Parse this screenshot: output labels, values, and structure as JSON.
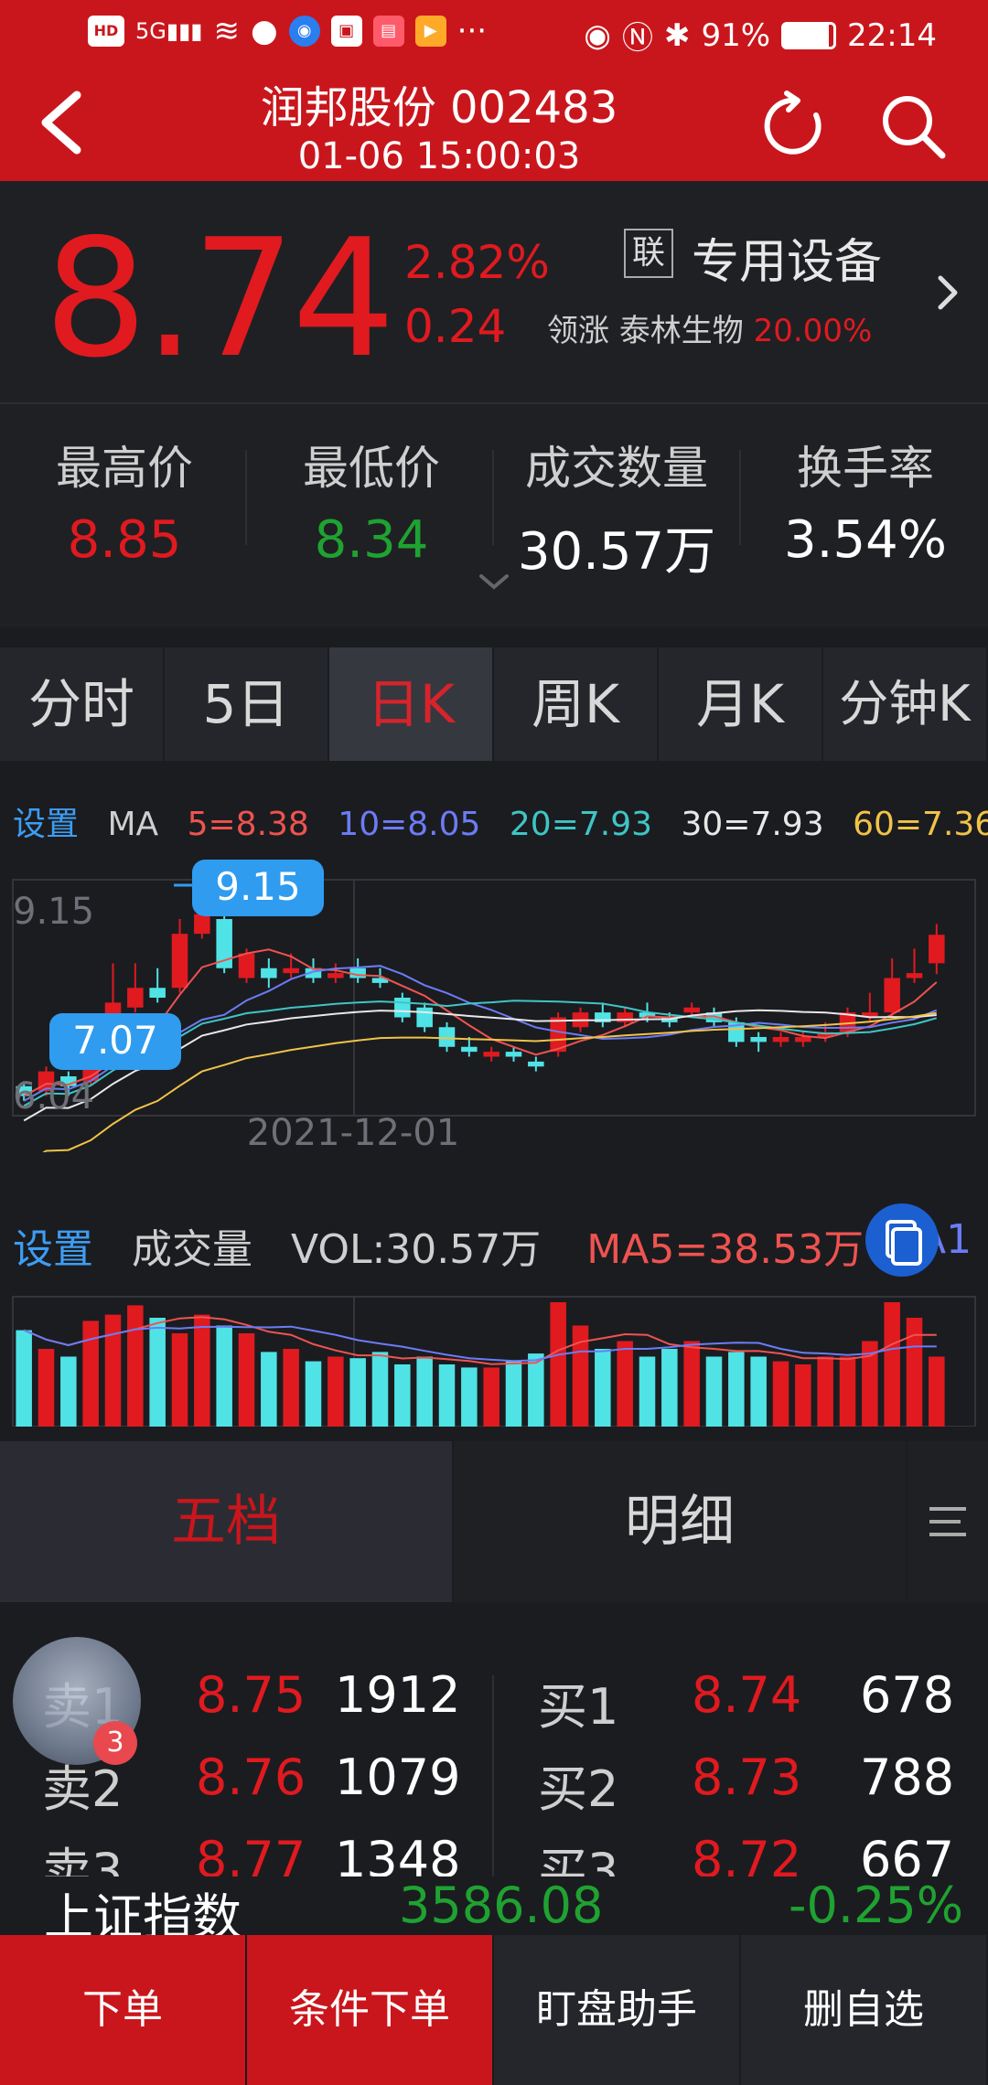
{
  "status_bar": {
    "left_tags": [
      "HD",
      "5G"
    ],
    "dots": "···",
    "battery": "91%",
    "time": "22:14"
  },
  "header": {
    "title": "润邦股份 002483",
    "datetime": "01-06 15:00:03"
  },
  "quote": {
    "price": "8.74",
    "change_pct": "2.82%",
    "change": "0.24",
    "sector_tag": "联",
    "sector_name": "专用设备",
    "lead_label": "领涨",
    "lead_stock": "泰林生物",
    "lead_pct": "20.00%"
  },
  "stats": [
    {
      "label": "最高价",
      "value": "8.85",
      "color": "#e01a1f"
    },
    {
      "label": "最低价",
      "value": "8.34",
      "color": "#1fa231"
    },
    {
      "label": "成交数量",
      "value": "30.57万",
      "color": "#ffffff"
    },
    {
      "label": "换手率",
      "value": "3.54%",
      "color": "#ffffff"
    }
  ],
  "tabs": [
    "分时",
    "5日",
    "日K",
    "周K",
    "月K",
    "分钟K"
  ],
  "active_tab": "日K",
  "ma": {
    "settings_label": "设置",
    "ma_label": "MA",
    "ma5": "5=8.38",
    "ma10": "10=8.05",
    "ma20": "20=7.93",
    "ma30": "30=7.93",
    "ma60": "60=7.36",
    "colors": {
      "ma5": "#ef5350",
      "ma10": "#6c7cf5",
      "ma20": "#3fc5c5",
      "ma30": "#e8e8e8",
      "ma60": "#f0c348"
    }
  },
  "kchart_labels": {
    "axis_high": "9.15",
    "axis_low": "6.04",
    "peak": "9.15",
    "trough": "7.07",
    "date": "2021-12-01"
  },
  "volume": {
    "settings_label": "设置",
    "label": "成交量",
    "vol": "VOL:30.57万",
    "ma5": "MA5=38.53万",
    "ma_cut": "A1"
  },
  "orderbook": {
    "tab_five": "五档",
    "tab_detail": "明细",
    "sell": [
      {
        "label": "卖1",
        "price": "8.75",
        "qty": "1912"
      },
      {
        "label": "卖2",
        "price": "8.76",
        "qty": "1079"
      },
      {
        "label": "卖3",
        "price": "8.77",
        "qty": "1348"
      }
    ],
    "buy": [
      {
        "label": "买1",
        "price": "8.74",
        "qty": "678"
      },
      {
        "label": "买2",
        "price": "8.73",
        "qty": "788"
      },
      {
        "label": "买3",
        "price": "8.72",
        "qty": "667"
      }
    ],
    "badge": "3"
  },
  "index_bar": {
    "name": "上证指数",
    "value": "3586.08",
    "change": "-0.25%"
  },
  "actions": [
    {
      "label": "下单",
      "bg": "#c9161c"
    },
    {
      "label": "条件下单",
      "bg": "#c9161c"
    },
    {
      "label": "盯盘助手",
      "bg": "#25262b"
    },
    {
      "label": "删自选",
      "bg": "#25262b"
    }
  ],
  "chart_data": {
    "type": "candlestick",
    "note_ma": "MA5 8.38, MA10 8.05, MA20 7.93, MA30 7.93, MA60 7.36",
    "candles": [
      {
        "o": 7.2,
        "c": 7.1,
        "h": 7.25,
        "l": 7.05
      },
      {
        "o": 7.15,
        "c": 7.35,
        "h": 7.4,
        "l": 7.1
      },
      {
        "o": 7.3,
        "c": 7.2,
        "h": 7.35,
        "l": 7.1
      },
      {
        "o": 7.25,
        "c": 7.55,
        "h": 7.6,
        "l": 7.2
      },
      {
        "o": 7.6,
        "c": 8.05,
        "h": 8.45,
        "l": 7.55
      },
      {
        "o": 8.0,
        "c": 8.2,
        "h": 8.45,
        "l": 7.95
      },
      {
        "o": 8.2,
        "c": 8.1,
        "h": 8.4,
        "l": 8.05
      },
      {
        "o": 8.2,
        "c": 8.75,
        "h": 8.9,
        "l": 8.15
      },
      {
        "o": 8.75,
        "c": 8.95,
        "h": 9.15,
        "l": 8.7
      },
      {
        "o": 8.9,
        "c": 8.4,
        "h": 9.05,
        "l": 8.35
      },
      {
        "o": 8.3,
        "c": 8.55,
        "h": 8.6,
        "l": 8.25
      },
      {
        "o": 8.4,
        "c": 8.3,
        "h": 8.5,
        "l": 8.2
      },
      {
        "o": 8.35,
        "c": 8.4,
        "h": 8.55,
        "l": 8.3
      },
      {
        "o": 8.4,
        "c": 8.3,
        "h": 8.5,
        "l": 8.25
      },
      {
        "o": 8.3,
        "c": 8.35,
        "h": 8.45,
        "l": 8.25
      },
      {
        "o": 8.4,
        "c": 8.3,
        "h": 8.5,
        "l": 8.25
      },
      {
        "o": 8.3,
        "c": 8.25,
        "h": 8.4,
        "l": 8.2
      },
      {
        "o": 8.1,
        "c": 7.9,
        "h": 8.15,
        "l": 7.85
      },
      {
        "o": 8.0,
        "c": 7.8,
        "h": 8.05,
        "l": 7.75
      },
      {
        "o": 7.8,
        "c": 7.6,
        "h": 7.85,
        "l": 7.55
      },
      {
        "o": 7.6,
        "c": 7.55,
        "h": 7.7,
        "l": 7.5
      },
      {
        "o": 7.5,
        "c": 7.55,
        "h": 7.6,
        "l": 7.45
      },
      {
        "o": 7.55,
        "c": 7.5,
        "h": 7.6,
        "l": 7.45
      },
      {
        "o": 7.45,
        "c": 7.4,
        "h": 7.5,
        "l": 7.35
      },
      {
        "o": 7.55,
        "c": 7.9,
        "h": 7.95,
        "l": 7.5
      },
      {
        "o": 7.8,
        "c": 7.95,
        "h": 8.0,
        "l": 7.75
      },
      {
        "o": 7.95,
        "c": 7.85,
        "h": 8.05,
        "l": 7.8
      },
      {
        "o": 7.85,
        "c": 7.95,
        "h": 8.0,
        "l": 7.8
      },
      {
        "o": 7.95,
        "c": 7.9,
        "h": 8.05,
        "l": 7.85
      },
      {
        "o": 7.9,
        "c": 7.85,
        "h": 7.95,
        "l": 7.8
      },
      {
        "o": 7.95,
        "c": 8.0,
        "h": 8.05,
        "l": 7.9
      },
      {
        "o": 7.95,
        "c": 7.85,
        "h": 8.0,
        "l": 7.8
      },
      {
        "o": 7.85,
        "c": 7.65,
        "h": 7.9,
        "l": 7.6
      },
      {
        "o": 7.7,
        "c": 7.65,
        "h": 7.75,
        "l": 7.55
      },
      {
        "o": 7.65,
        "c": 7.7,
        "h": 7.75,
        "l": 7.6
      },
      {
        "o": 7.65,
        "c": 7.7,
        "h": 7.75,
        "l": 7.6
      },
      {
        "o": 7.7,
        "c": 7.75,
        "h": 7.85,
        "l": 7.65
      },
      {
        "o": 7.75,
        "c": 7.95,
        "h": 8.0,
        "l": 7.7
      },
      {
        "o": 7.9,
        "c": 7.95,
        "h": 8.15,
        "l": 7.85
      },
      {
        "o": 7.95,
        "c": 8.3,
        "h": 8.5,
        "l": 7.9
      },
      {
        "o": 8.3,
        "c": 8.35,
        "h": 8.6,
        "l": 8.25
      },
      {
        "o": 8.45,
        "c": 8.74,
        "h": 8.85,
        "l": 8.34
      }
    ],
    "volumes": [
      62,
      50,
      45,
      68,
      72,
      78,
      70,
      60,
      72,
      65,
      60,
      48,
      50,
      42,
      45,
      44,
      48,
      40,
      45,
      40,
      38,
      38,
      42,
      47,
      80,
      65,
      50,
      55,
      45,
      50,
      55,
      45,
      48,
      45,
      42,
      40,
      45,
      45,
      55,
      80,
      70,
      45
    ],
    "ymin": 6.9,
    "ymax": 9.3
  }
}
